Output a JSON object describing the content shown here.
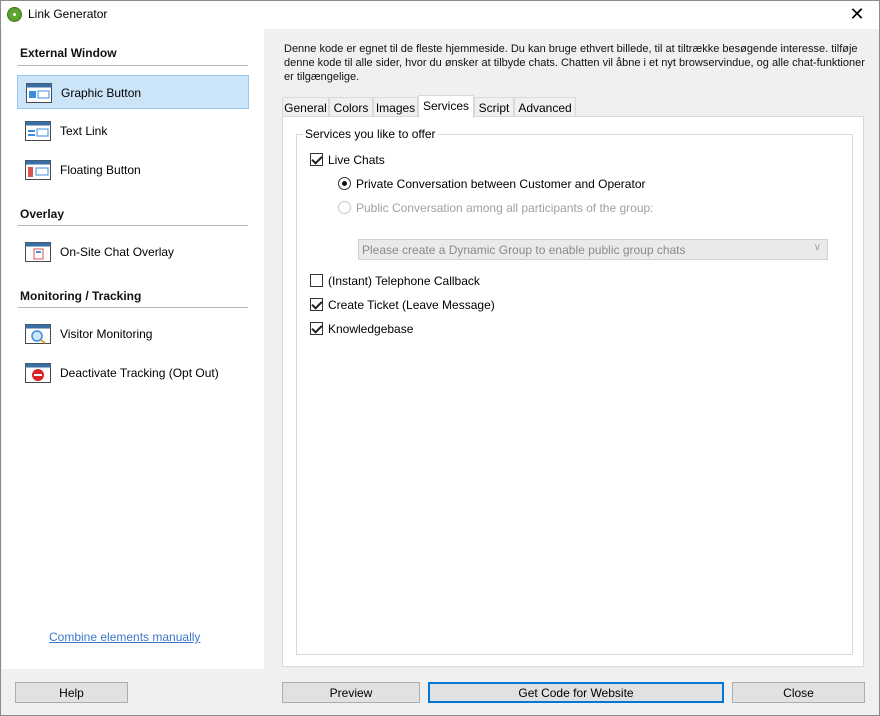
{
  "window": {
    "title": "Link Generator",
    "close_glyph": "✕"
  },
  "sidebar": {
    "sections": [
      {
        "title": "External Window"
      },
      {
        "title": "Overlay"
      },
      {
        "title": "Monitoring / Tracking"
      }
    ],
    "items": [
      {
        "label": "Graphic Button",
        "icon": "graphic-button-icon",
        "selected": true
      },
      {
        "label": "Text Link",
        "icon": "text-link-icon"
      },
      {
        "label": "Floating Button",
        "icon": "floating-button-icon"
      },
      {
        "label": "On-Site Chat Overlay",
        "icon": "chat-overlay-icon"
      },
      {
        "label": "Visitor Monitoring",
        "icon": "visitor-monitoring-icon"
      },
      {
        "label": "Deactivate Tracking (Opt Out)",
        "icon": "deactivate-tracking-icon"
      }
    ],
    "combine_link": "Combine elements manually"
  },
  "description": "Denne kode er egnet til de fleste hjemmeside. Du kan bruge ethvert billede, til at tiltrække besøgende interesse. tilføje denne kode til alle sider, hvor du ønsker at tilbyde chats. Chatten vil åbne i et nyt browservindue, og alle chat-funktioner er tilgængelige.",
  "tabs": [
    {
      "label": "General"
    },
    {
      "label": "Colors"
    },
    {
      "label": "Images"
    },
    {
      "label": "Services",
      "active": true
    },
    {
      "label": "Script"
    },
    {
      "label": "Advanced"
    }
  ],
  "services": {
    "group_title": "Services you like to offer",
    "live_chats": {
      "label": "Live Chats",
      "checked": true
    },
    "private_conversation": {
      "label": "Private Conversation between Customer and Operator",
      "selected": true
    },
    "public_conversation": {
      "label": "Public Conversation among all participants of the group:",
      "enabled": false
    },
    "group_select": {
      "value": "Please create a Dynamic Group to enable public group chats",
      "enabled": false
    },
    "telephone_callback": {
      "label": "(Instant) Telephone Callback",
      "checked": false
    },
    "create_ticket": {
      "label": "Create Ticket (Leave Message)",
      "checked": true
    },
    "knowledgebase": {
      "label": "Knowledgebase",
      "checked": true
    }
  },
  "buttons": {
    "help": "Help",
    "preview": "Preview",
    "get_code": "Get Code for Website",
    "close": "Close"
  },
  "colors": {
    "selection": "#cce4f7",
    "selection_border": "#99c9ef",
    "link": "#3c78c8",
    "primary_border": "#0078d7"
  }
}
